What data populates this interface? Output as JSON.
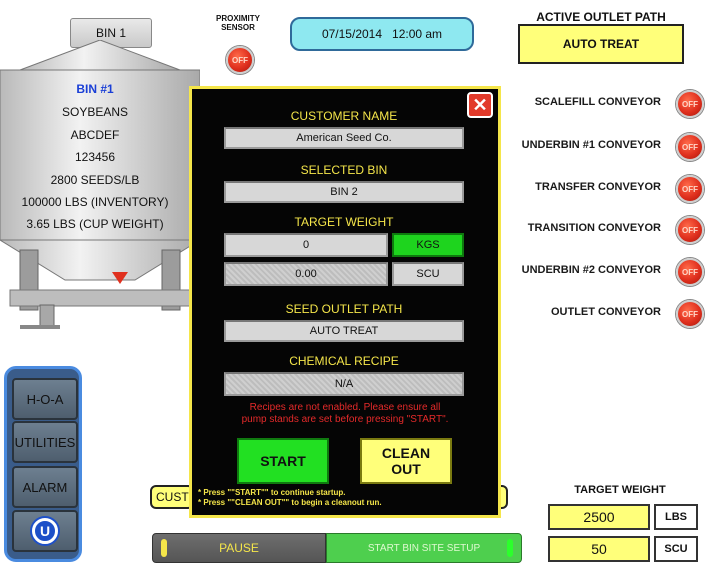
{
  "bin": {
    "tab_label": "BIN 1",
    "name": "BIN #1",
    "crop": "SOYBEANS",
    "line2": "ABCDEF",
    "line3": "123456",
    "seeds_per_lb": "2800 SEEDS/LB",
    "inventory": "100000 LBS (INVENTORY)",
    "cup_weight": "3.65 LBS (CUP WEIGHT)"
  },
  "proximity_sensor": {
    "label": "PROXIMITY SENSOR",
    "state": "OFF"
  },
  "datetime": "07/15/2014   12:00 am",
  "active_outlet": {
    "title": "ACTIVE OUTLET PATH",
    "value": "AUTO TREAT"
  },
  "conveyors": [
    {
      "label": "SCALEFILL CONVEYOR",
      "state": "OFF"
    },
    {
      "label": "UNDERBIN #1 CONVEYOR",
      "state": "OFF"
    },
    {
      "label": "TRANSFER CONVEYOR",
      "state": "OFF"
    },
    {
      "label": "TRANSITION CONVEYOR",
      "state": "OFF"
    },
    {
      "label": "UNDERBIN #2 CONVEYOR",
      "state": "OFF"
    },
    {
      "label": "OUTLET CONVEYOR",
      "state": "OFF"
    }
  ],
  "nav": {
    "hoa": "H-O-A",
    "utilities": "UTILITIES",
    "alarm": "ALARM",
    "logo": "U"
  },
  "partial_customer_label": "CUST",
  "bottom": {
    "pause": "PAUSE",
    "start_bin_site": "START BIN SITE SETUP"
  },
  "target_weight_panel": {
    "title": "TARGET WEIGHT",
    "weight_value": "2500",
    "weight_unit": "LBS",
    "scu_value": "50",
    "scu_unit": "SCU"
  },
  "dialog": {
    "close_symbol": "✕",
    "customer_name_label": "CUSTOMER NAME",
    "customer_name_value": "American Seed Co.",
    "selected_bin_label": "SELECTED BIN",
    "selected_bin_value": "BIN 2",
    "target_weight_label": "TARGET WEIGHT",
    "target_weight_value": "0",
    "kgs_label": "KGS",
    "scu_value": "0.00",
    "scu_label": "SCU",
    "seed_outlet_label": "SEED OUTLET PATH",
    "seed_outlet_value": "AUTO TREAT",
    "chemical_recipe_label": "CHEMICAL RECIPE",
    "chemical_recipe_value": "N/A",
    "warning_line1": "Recipes are not enabled. Please ensure all",
    "warning_line2": "pump stands are set before pressing \"START\".",
    "start_label": "START",
    "clean_out_line1": "CLEAN",
    "clean_out_line2": "OUT",
    "note1": "* Press \"\"START\"\" to continue startup.",
    "note2": "* Press \"\"CLEAN OUT\"\" to begin a cleanout run."
  }
}
